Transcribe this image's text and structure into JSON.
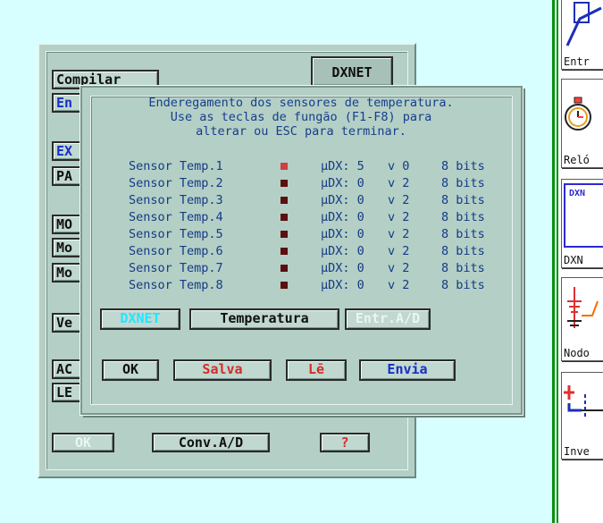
{
  "back_panel": {
    "buttons": {
      "compilar": "Compilar",
      "en_partial": "En",
      "ex_partial": "EX",
      "pa_partial": "PA",
      "mo1_partial": "MO",
      "mo2_partial": "Mo",
      "mo3_partial": "Mo",
      "ve_partial": "Ve",
      "ac_partial": "AC",
      "le_partial": "LE",
      "ok": "OK",
      "conv_ad": "Conv.A/D",
      "help": "?"
    }
  },
  "tabs": {
    "dxnet_top": "DXNET",
    "dxnet": "DXNET",
    "temperatura": "Temperatura",
    "entr_ad": "Entr.A/D"
  },
  "dialog": {
    "message": [
      "Enderegamento dos sensores de temperatura.",
      "Use as teclas de fungão (F1-F8) para",
      "alterar ou ESC para terminar."
    ],
    "sensors": [
      {
        "name": "Sensor Temp.1",
        "udx": "µDX: 5",
        "v": "v 0",
        "bits": "8 bits",
        "selected": true
      },
      {
        "name": "Sensor Temp.2",
        "udx": "µDX: 0",
        "v": "v 2",
        "bits": "8 bits",
        "selected": false
      },
      {
        "name": "Sensor Temp.3",
        "udx": "µDX: 0",
        "v": "v 2",
        "bits": "8 bits",
        "selected": false
      },
      {
        "name": "Sensor Temp.4",
        "udx": "µDX: 0",
        "v": "v 2",
        "bits": "8 bits",
        "selected": false
      },
      {
        "name": "Sensor Temp.5",
        "udx": "µDX: 0",
        "v": "v 2",
        "bits": "8 bits",
        "selected": false
      },
      {
        "name": "Sensor Temp.6",
        "udx": "µDX: 0",
        "v": "v 2",
        "bits": "8 bits",
        "selected": false
      },
      {
        "name": "Sensor Temp.7",
        "udx": "µDX: 0",
        "v": "v 2",
        "bits": "8 bits",
        "selected": false
      },
      {
        "name": "Sensor Temp.8",
        "udx": "µDX: 0",
        "v": "v 2",
        "bits": "8 bits",
        "selected": false
      }
    ],
    "buttons": {
      "ok": "OK",
      "salva": "Salva",
      "le": "Lē",
      "envia": "Envia"
    }
  },
  "palette": {
    "items": [
      {
        "label": "Entr",
        "icon": "input-block-icon"
      },
      {
        "label": "Reló",
        "icon": "stopwatch-icon"
      },
      {
        "label": "DXN",
        "icon": "dxnet-module-icon"
      },
      {
        "label": "Nodo",
        "icon": "ground-node-icon"
      },
      {
        "label": "Inve",
        "icon": "inverter-icon"
      }
    ]
  },
  "colors": {
    "background": "#d7ffff",
    "panel": "#b4cfc5",
    "dialog_text": "#163e8c",
    "selected_swatch": "#d04040",
    "swatch": "#5a1010",
    "border_green": "#0a8f0a"
  }
}
